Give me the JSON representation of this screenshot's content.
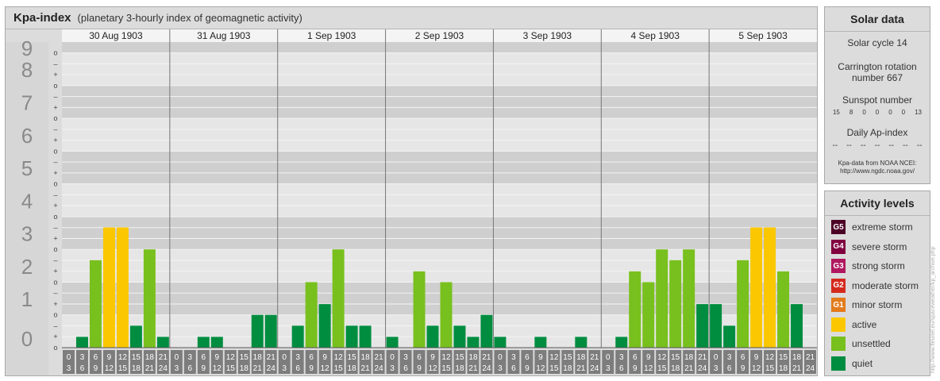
{
  "title": "Kpa-index",
  "subtitle": "(planetary 3-hourly index of geomagnetic activity)",
  "chart_data": {
    "type": "bar",
    "days": [
      "30 Aug 1903",
      "31 Aug 1903",
      "1 Sep 1903",
      "2 Sep 1903",
      "3 Sep 1903",
      "4 Sep 1903",
      "5 Sep 1903"
    ],
    "hour_start_labels": [
      "0",
      "3",
      "6",
      "9",
      "12",
      "15",
      "18",
      "21"
    ],
    "hour_end_labels": [
      "3",
      "6",
      "9",
      "12",
      "15",
      "18",
      "21",
      "24"
    ],
    "y_major_labels": [
      "0",
      "1",
      "2",
      "3",
      "4",
      "5",
      "6",
      "7",
      "8",
      "9"
    ],
    "y_minor_labels": [
      "+",
      "–",
      "o"
    ],
    "ylim": [
      0,
      9.33
    ],
    "values": [
      [
        0,
        0.33,
        2.67,
        3.67,
        3.67,
        0.67,
        3.0,
        0.33
      ],
      [
        0,
        0,
        0.33,
        0.33,
        0,
        0,
        1.0,
        1.0
      ],
      [
        0,
        0.67,
        2.0,
        1.33,
        3.0,
        0.67,
        0.67,
        0
      ],
      [
        0.33,
        0,
        2.33,
        0.67,
        2.0,
        0.67,
        0.33,
        1.0
      ],
      [
        0.33,
        0,
        0,
        0.33,
        0,
        0,
        0.33,
        0
      ],
      [
        0,
        0.33,
        2.33,
        2.0,
        3.0,
        2.67,
        3.0,
        1.33
      ],
      [
        1.33,
        0.67,
        2.67,
        3.67,
        3.67,
        2.33,
        1.33,
        0
      ]
    ],
    "levels": [
      {
        "name": "quiet",
        "color": "#008d40"
      },
      {
        "name": "unsettled",
        "color": "#78c01d"
      },
      {
        "name": "active",
        "color": "#fac700"
      }
    ]
  },
  "solar": {
    "title": "Solar data",
    "cycle": "Solar cycle 14",
    "rotation_line1": "Carrington rotation",
    "rotation_line2": "number 667",
    "sunspot_title": "Sunspot number",
    "sunspot_values": [
      "15",
      "8",
      "0",
      "0",
      "0",
      "0",
      "13"
    ],
    "ap_title": "Daily Ap-index",
    "ap_values": [
      "--",
      "--",
      "--",
      "--",
      "--",
      "--",
      "--"
    ],
    "credit_line1": "Kpa-data from NOAA NCEI:",
    "credit_line2": "http://www.ngdc.noaa.gov/"
  },
  "activity": {
    "title": "Activity levels",
    "items": [
      {
        "badge": "G5",
        "label": "extreme storm",
        "color": "#4d0026"
      },
      {
        "badge": "G4",
        "label": "severe storm",
        "color": "#800040"
      },
      {
        "badge": "G3",
        "label": "strong storm",
        "color": "#b0185f"
      },
      {
        "badge": "G2",
        "label": "moderate storm",
        "color": "#d42a1e"
      },
      {
        "badge": "G1",
        "label": "minor storm",
        "color": "#e27b1c"
      },
      {
        "badge": "",
        "label": "active",
        "color": "#fac700"
      },
      {
        "badge": "",
        "label": "unsettled",
        "color": "#78c01d"
      },
      {
        "badge": "",
        "label": "quiet",
        "color": "#008d40"
      }
    ]
  },
  "watermark": "http://www.fleuriel.eu/spaceweather/kp_archive.php"
}
